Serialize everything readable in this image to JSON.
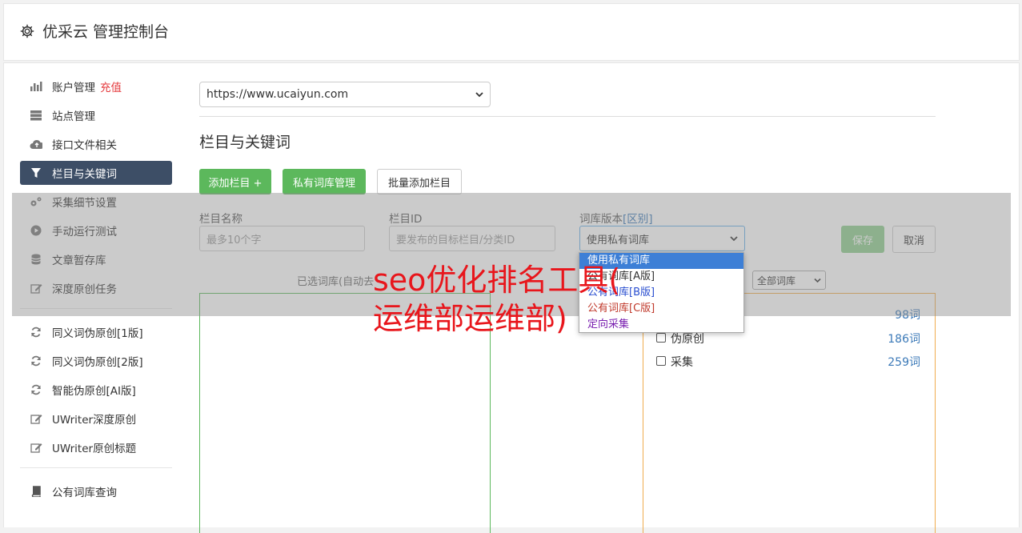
{
  "header": {
    "title": "优采云 管理控制台"
  },
  "sidebar": {
    "items": [
      {
        "label": "账户管理",
        "extra": "充值",
        "icon": "bar-chart-icon"
      },
      {
        "label": "站点管理",
        "icon": "server-icon"
      },
      {
        "label": "接口文件相关",
        "icon": "cloud-upload-icon"
      },
      {
        "label": "栏目与关键词",
        "icon": "filter-icon",
        "active": true
      },
      {
        "label": "采集细节设置",
        "icon": "gears-icon"
      },
      {
        "label": "手动运行测试",
        "icon": "play-circle-icon"
      },
      {
        "label": "文章暂存库",
        "icon": "database-icon"
      },
      {
        "label": "深度原创任务",
        "icon": "edit-icon"
      }
    ],
    "items2": [
      {
        "label": "同义词伪原创[1版]",
        "icon": "refresh-icon"
      },
      {
        "label": "同义词伪原创[2版]",
        "icon": "refresh-icon"
      },
      {
        "label": "智能伪原创[AI版]",
        "icon": "refresh-icon"
      },
      {
        "label": "UWriter深度原创",
        "icon": "edit-icon"
      },
      {
        "label": "UWriter原创标题",
        "icon": "edit-icon"
      }
    ],
    "items3": [
      {
        "label": "公有词库查询",
        "icon": "book-icon"
      }
    ]
  },
  "main": {
    "site_select": "https://www.ucaiyun.com",
    "section_title": "栏目与关键词",
    "buttons": {
      "add_column": "添加栏目 +",
      "private_lib": "私有词库管理",
      "batch_add": "批量添加栏目"
    },
    "form": {
      "name_label": "栏目名称",
      "name_placeholder": "最多10个字",
      "id_label": "栏目ID",
      "id_placeholder": "要发布的目标栏目/分类ID",
      "version_label": "词库版本",
      "version_hint": "[区别]",
      "version_value": "使用私有词库",
      "save": "保存",
      "cancel": "取消"
    },
    "selected_label": "已选词库(自动去",
    "all_lib_select": "全部词库",
    "lib_rows": [
      {
        "label": "",
        "count": "98词"
      },
      {
        "label": "伪原创",
        "count": "186词"
      },
      {
        "label": "采集",
        "count": "259词"
      }
    ],
    "dropdown": [
      {
        "label": "使用私有词库",
        "color": "#ffffff"
      },
      {
        "label": "公有词库[A版]",
        "color": "#333333"
      },
      {
        "label": "公有词库[B版]",
        "color": "#2a4fd0"
      },
      {
        "label": "公有词库[C版]",
        "color": "#c0392b"
      },
      {
        "label": "定向采集",
        "color": "#7a1fb0"
      }
    ]
  },
  "watermark": {
    "line1": "seo优化排名工具(",
    "line2": "运维部运维部)"
  }
}
